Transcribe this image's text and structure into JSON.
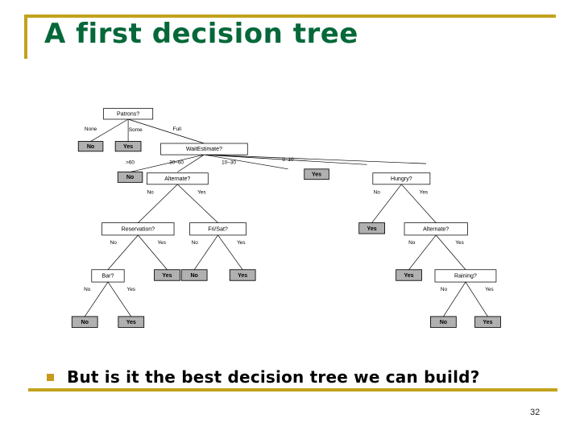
{
  "slide": {
    "title": "A first decision tree",
    "page_number": "32",
    "accent_color": "#c3a21c",
    "title_color": "#046839"
  },
  "bullet": {
    "marker": "square-bullet",
    "text": "But is it the best decision tree we can build?"
  },
  "diagram": {
    "name": "restaurant-decision-tree",
    "nodes": {
      "patrons": "Patrons?",
      "wait_estimate": "WaitEstimate?",
      "alternate_left": "Alternate?",
      "hungry": "Hungry?",
      "reservation": "Reservation?",
      "fri_sat": "Fri/Sat?",
      "alternate_right": "Alternate?",
      "bar": "Bar?",
      "raining": "Raining?"
    },
    "leaves": {
      "patrons_none": "No",
      "patrons_some": "Yes",
      "wait_gt60": "No",
      "wait_0_10": "Yes",
      "hungry_no": "Yes",
      "reservation_yes": "Yes",
      "frisat_no": "No",
      "frisat_yes": "Yes",
      "alt_right_no": "Yes",
      "bar_no": "No",
      "bar_yes": "Yes",
      "raining_no": "No",
      "raining_yes": "Yes"
    },
    "edge_labels": {
      "patrons_none": "None",
      "patrons_some": "Some",
      "patrons_full": "Full",
      "wait_gt60": ">60",
      "wait_30_60": "30–60",
      "wait_10_30": "10–30",
      "wait_0_10": "0–10",
      "alt_left_no": "No",
      "alt_left_yes": "Yes",
      "hungry_no": "No",
      "hungry_yes": "Yes",
      "res_no": "No",
      "res_yes": "Yes",
      "frisat_no": "No",
      "frisat_yes": "Yes",
      "alt_right_no": "No",
      "alt_right_yes": "Yes",
      "bar_no": "No",
      "bar_yes": "Yes",
      "rain_no": "No",
      "rain_yes": "Yes"
    }
  }
}
